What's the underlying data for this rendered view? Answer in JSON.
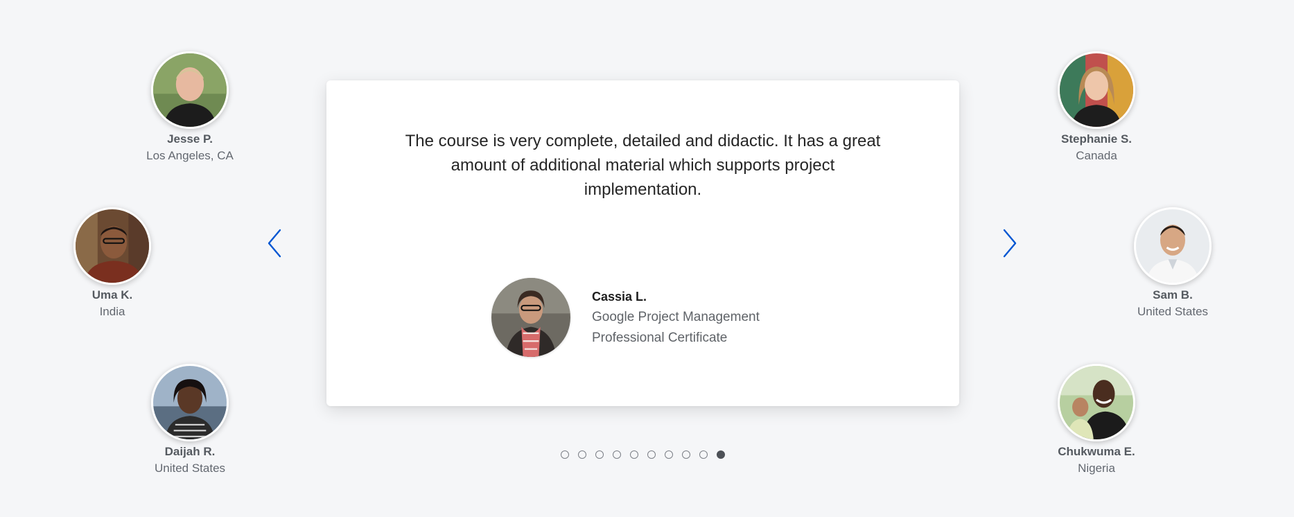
{
  "reviewers_left": [
    {
      "name": "Jesse P.",
      "location": "Los Angeles, CA"
    },
    {
      "name": "Uma K.",
      "location": "India"
    },
    {
      "name": "Daijah R.",
      "location": "United States"
    }
  ],
  "reviewers_right": [
    {
      "name": "Stephanie S.",
      "location": "Canada"
    },
    {
      "name": "Sam B.",
      "location": "United States"
    },
    {
      "name": "Chukwuma E.",
      "location": "Nigeria"
    }
  ],
  "testimonial": {
    "quote": "The course is very complete, detailed and didactic. It has a great amount of additional material which supports project implementation.",
    "author_name": "Cassia L.",
    "course_line1": "Google Project Management",
    "course_line2": "Professional Certificate"
  },
  "carousel": {
    "slide_count": 10,
    "active_slide": 10
  },
  "colors": {
    "background": "#f5f6f8",
    "arrow": "#0056d2",
    "dot_active": "#4d5157"
  },
  "icons": {
    "previous": "chevron-left-icon",
    "next": "chevron-right-icon"
  }
}
